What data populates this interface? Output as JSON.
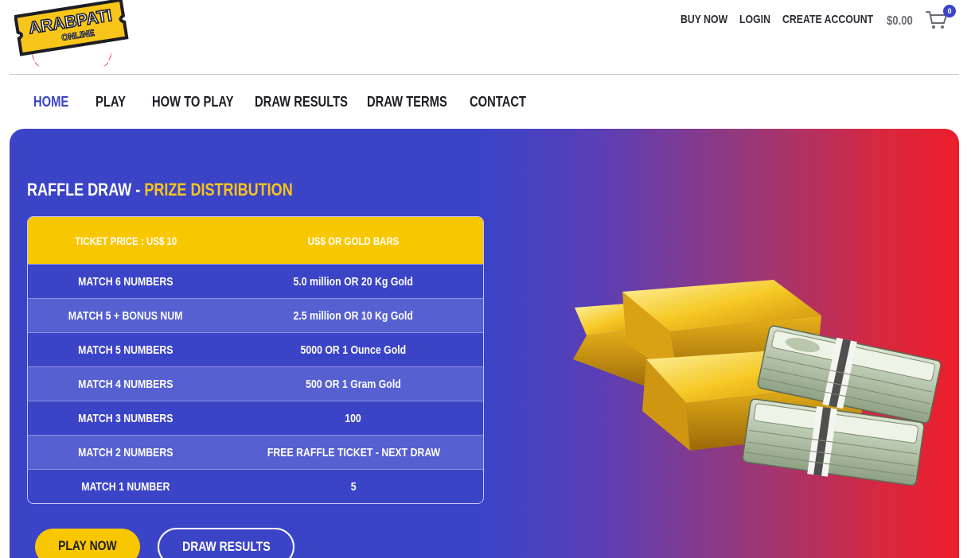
{
  "logo": {
    "line1": "ARABPATI",
    "line2": "ONLINE"
  },
  "top_nav": {
    "buy_now": "BUY NOW",
    "login": "LOGIN",
    "create_account": "CREATE ACCOUNT",
    "cart_total": "$0.00",
    "cart_count": "0"
  },
  "main_nav": [
    {
      "label": "HOME",
      "active": true
    },
    {
      "label": "PLAY"
    },
    {
      "label": "HOW TO PLAY"
    },
    {
      "label": "DRAW RESULTS"
    },
    {
      "label": "DRAW TERMS"
    },
    {
      "label": "CONTACT"
    }
  ],
  "hero": {
    "title_prefix": "RAFFLE DRAW - ",
    "title_highlight": "PRIZE DISTRIBUTION",
    "table": {
      "header": [
        "TICKET PRICE : US$ 10",
        "US$ OR GOLD BARS"
      ],
      "rows": [
        [
          "MATCH 6 NUMBERS",
          "5.0 million OR 20 Kg Gold"
        ],
        [
          "MATCH 5 + BONUS NUM",
          "2.5 million OR 10 Kg Gold"
        ],
        [
          "MATCH 5 NUMBERS",
          "5000 OR 1 Ounce Gold"
        ],
        [
          "MATCH 4 NUMBERS",
          "500 OR 1 Gram Gold"
        ],
        [
          "MATCH 3 NUMBERS",
          "100"
        ],
        [
          "MATCH 2 NUMBERS",
          "FREE RAFFLE TICKET - NEXT DRAW"
        ],
        [
          "MATCH 1 NUMBER",
          "5"
        ]
      ]
    },
    "play_now_label": "PLAY NOW",
    "draw_results_label": "DRAW RESULTS"
  },
  "colors": {
    "brand_blue": "#3b44c7",
    "brand_yellow": "#f9c700",
    "gradient_red": "#ed1e2c"
  }
}
